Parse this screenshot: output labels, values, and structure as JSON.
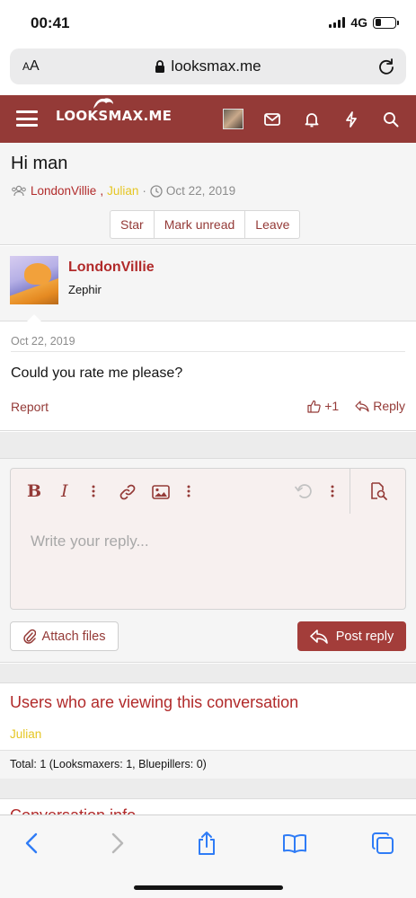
{
  "status_bar": {
    "time": "00:41",
    "network": "4G",
    "battery_level": 0.3
  },
  "browser": {
    "text_size": "AA",
    "url": "looksmax.me",
    "reload_icon": "reload-icon"
  },
  "site": {
    "logo": "LOOKSMAX.ME",
    "brand_color": "#943a37",
    "nav_icons": [
      "menu-icon",
      "avatar",
      "inbox-icon",
      "bell-icon",
      "bolt-icon",
      "search-icon"
    ]
  },
  "conversation": {
    "title": "Hi man",
    "participants": [
      "LondonVillie",
      "Julian"
    ],
    "participant_separator": ",",
    "meta_dot": "·",
    "date": "Oct 22, 2019",
    "buttons": {
      "star": "Star",
      "mark_unread": "Mark unread",
      "leave": "Leave"
    }
  },
  "message": {
    "username": "LondonVillie",
    "user_title": "Zephir",
    "date": "Oct 22, 2019",
    "text": "Could you rate me please?",
    "report": "Report",
    "like_count": "+1",
    "reply": "Reply"
  },
  "editor": {
    "placeholder": "Write your reply...",
    "toolbar": [
      "bold-icon",
      "italic-icon",
      "more-icon",
      "link-icon",
      "image-icon",
      "more-icon",
      "undo-icon",
      "more-icon",
      "preview-icon"
    ],
    "bold": "B",
    "italic": "I",
    "attach_label": "Attach files",
    "post_label": "Post reply"
  },
  "viewers": {
    "title": "Users who are viewing this conversation",
    "users": "Julian",
    "total": "Total: 1 (Looksmaxers: 1, Bluepillers: 0)"
  },
  "conversation_info": {
    "title": "Conversation info"
  },
  "colors": {
    "accent": "#943a37",
    "username_red": "#b12a2a",
    "username_yellow": "#e5c623",
    "safari_blue": "#2f7cf6"
  }
}
